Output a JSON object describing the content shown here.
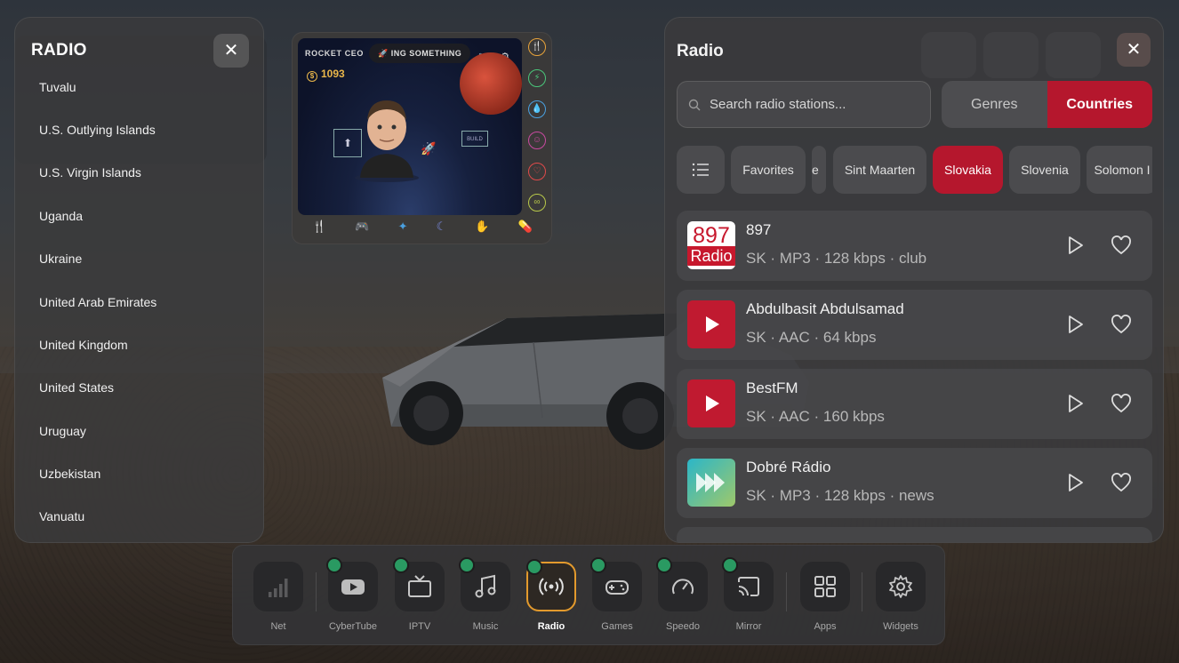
{
  "left_panel": {
    "title": "RADIO",
    "countries": [
      "Tuvalu",
      "U.S. Outlying Islands",
      "U.S. Virgin Islands",
      "Uganda",
      "Ukraine",
      "United Arab Emirates",
      "United Kingdom",
      "United States",
      "Uruguay",
      "Uzbekistan",
      "Vanuatu"
    ]
  },
  "game": {
    "title": "ROCKET CEO",
    "status": "🚀 ING SOMETHING",
    "coins": "1093",
    "build_label": "BUILD"
  },
  "right_panel": {
    "title": "Radio",
    "search_placeholder": "Search radio stations...",
    "tabs": {
      "genres": "Genres",
      "countries": "Countries",
      "active": "Countries"
    },
    "chips": [
      "Favorites",
      "e",
      "Sint Maarten",
      "Slovakia",
      "Slovenia",
      "Solomon I"
    ],
    "active_chip": "Slovakia",
    "stations": [
      {
        "name": "897",
        "meta": "SK · MP3 · 128 kbps · club",
        "logo_text_top": "897",
        "logo_text_bottom": "Radio"
      },
      {
        "name": "Abdulbasit Abdulsamad",
        "meta": "SK · AAC · 64 kbps"
      },
      {
        "name": "BestFM",
        "meta": "SK · AAC · 160 kbps"
      },
      {
        "name": "Dobré Rádio",
        "meta": "SK · MP3 · 128 kbps · news"
      }
    ]
  },
  "dock": {
    "items": [
      {
        "label": "Net",
        "icon": "signal-bars-icon"
      },
      {
        "label": "CyberTube",
        "icon": "youtube-icon"
      },
      {
        "label": "IPTV",
        "icon": "tv-icon"
      },
      {
        "label": "Music",
        "icon": "music-note-icon"
      },
      {
        "label": "Radio",
        "icon": "radio-waves-icon",
        "active": true
      },
      {
        "label": "Games",
        "icon": "gamepad-icon"
      },
      {
        "label": "Speedo",
        "icon": "speedometer-icon"
      },
      {
        "label": "Mirror",
        "icon": "cast-icon"
      },
      {
        "label": "Apps",
        "icon": "grid-icon"
      },
      {
        "label": "Widgets",
        "icon": "gear-icon"
      }
    ]
  },
  "colors": {
    "accent_red": "#b5172d",
    "active_orange": "#e39a2d",
    "badge_green": "#2a9a62"
  }
}
